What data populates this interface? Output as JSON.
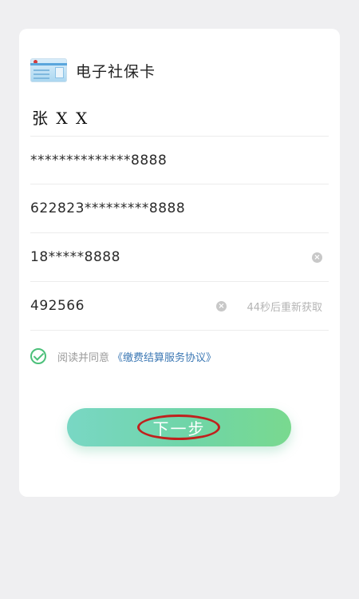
{
  "app": {
    "title": "电子社保卡",
    "card_icon": "social-security-card-icon"
  },
  "form": {
    "name": "张 X X",
    "id_number": "**************8888",
    "bank_card": "622823*********8888",
    "phone": "18*****8888",
    "verification_code": "492566",
    "resend_countdown": "44秒后重新获取"
  },
  "agreement": {
    "checked": true,
    "text": "阅读并同意",
    "link": "《缴费结算服务协议》"
  },
  "actions": {
    "next_label": "下一步"
  },
  "colors": {
    "accent_green": "#4cc07a",
    "link_blue": "#3c78b4",
    "highlight_red": "#c0201d",
    "button_gradient_start": "#79d7c4",
    "button_gradient_end": "#79d98f"
  }
}
